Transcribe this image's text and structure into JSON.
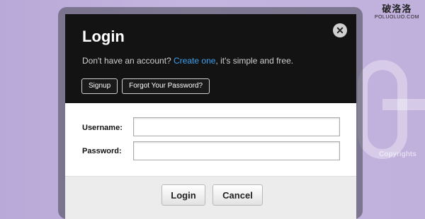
{
  "watermark": {
    "site_cn": "破洛洛",
    "site_url": "POLUOLUO.COM"
  },
  "background": {
    "text": "Copyrights"
  },
  "dialog": {
    "title": "Login",
    "close_glyph": "✕",
    "subtitle_before": "Don't have an account? ",
    "subtitle_link": "Create one",
    "subtitle_after": ", it's simple and free.",
    "signup_label": "Signup",
    "forgot_label": "Forgot Your Password?",
    "username_label": "Username:",
    "username_value": "",
    "password_label": "Password:",
    "password_value": "",
    "login_label": "Login",
    "cancel_label": "Cancel"
  },
  "colors": {
    "header_bg": "#131313",
    "link": "#3aa1f2",
    "page_bg": "#c4b5e0"
  },
  "icons": {
    "close": "close-icon"
  }
}
